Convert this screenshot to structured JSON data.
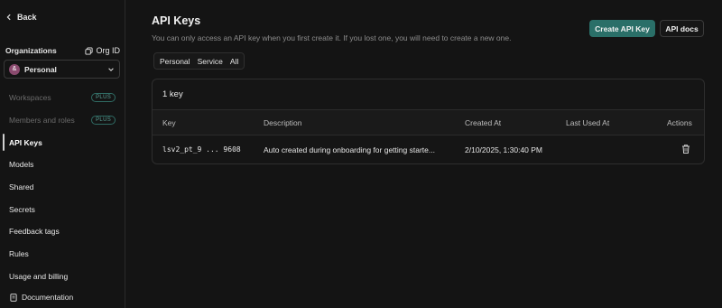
{
  "sidebar": {
    "back_label": "Back",
    "org_title": "Organizations",
    "org_id_label": "Org ID",
    "org_name": "Personal",
    "avatar_initial": "&",
    "items": [
      {
        "label": "Workspaces",
        "badge": "PLUS",
        "disabled": true
      },
      {
        "label": "Members and roles",
        "badge": "PLUS",
        "disabled": true
      },
      {
        "label": "API Keys",
        "active": true
      },
      {
        "label": "Models"
      },
      {
        "label": "Shared"
      },
      {
        "label": "Secrets"
      },
      {
        "label": "Feedback tags"
      },
      {
        "label": "Rules"
      },
      {
        "label": "Usage and billing"
      }
    ],
    "documentation_label": "Documentation"
  },
  "main": {
    "title": "API Keys",
    "subtitle": "You can only access an API key when you first create it. If you lost one, you will need to create a new one.",
    "create_button": "Create API Key",
    "docs_button": "API docs",
    "filters": [
      "Personal",
      "Service",
      "All"
    ],
    "key_count": "1 key",
    "table": {
      "columns": [
        "Key",
        "Description",
        "Created At",
        "Last Used At",
        "Actions"
      ],
      "rows": [
        {
          "key": "lsv2_pt_9 ... 9608",
          "description": "Auto created during onboarding for getting starte...",
          "created_at": "2/10/2025, 1:30:40 PM",
          "last_used_at": ""
        }
      ]
    }
  },
  "colors": {
    "accent": "#2a6f68",
    "background": "#141414",
    "plus_badge": "#5aa399"
  }
}
